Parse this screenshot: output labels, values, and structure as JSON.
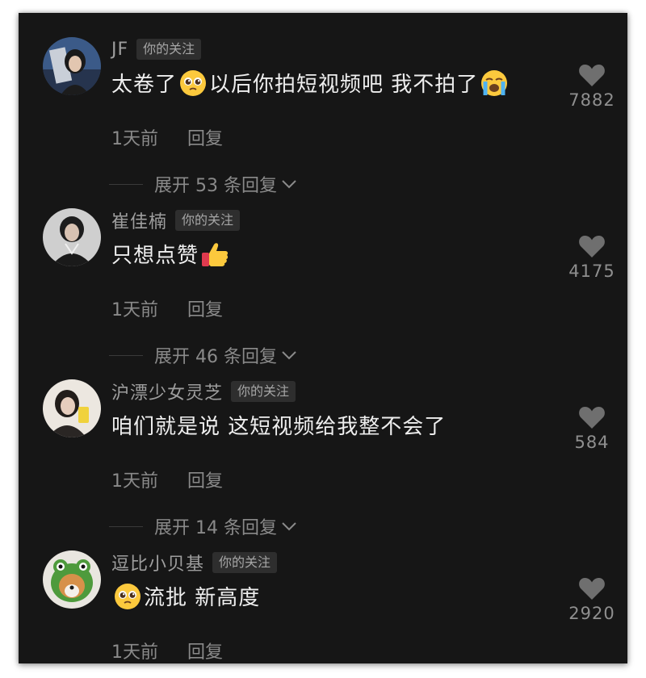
{
  "comments": [
    {
      "username": "JF",
      "badge": "你的关注",
      "text_before": "太卷了",
      "emoji_mid": "pleading-face",
      "text_after": "以后你拍短视频吧 我不拍了",
      "emoji_end": "loudly-crying-face",
      "time": "1天前",
      "reply_label": "回复",
      "expand_label": "展开 53 条回复",
      "likes": "7882",
      "icons": [
        "heart-icon",
        "chevron-down-icon"
      ]
    },
    {
      "username": "崔佳楠",
      "badge": "你的关注",
      "text": "只想点赞",
      "emoji_end": "thumbs-up",
      "time": "1天前",
      "reply_label": "回复",
      "expand_label": "展开 46 条回复",
      "likes": "4175"
    },
    {
      "username": "沪漂少女灵芝",
      "badge": "你的关注",
      "text": "咱们就是说 这短视频给我整不会了",
      "time": "1天前",
      "reply_label": "回复",
      "expand_label": "展开 14 条回复",
      "likes": "584"
    },
    {
      "username": "逗比小贝基",
      "badge": "你的关注",
      "emoji_start": "pleading-face",
      "text": "流批 新高度",
      "time": "1天前",
      "reply_label": "回复",
      "likes": "2920"
    }
  ],
  "colors": {
    "background": "#161616",
    "username": "#9e9e9e",
    "comment_text": "#eeeeee",
    "meta": "#8a8a8a",
    "heart": "#6f6f6f"
  }
}
